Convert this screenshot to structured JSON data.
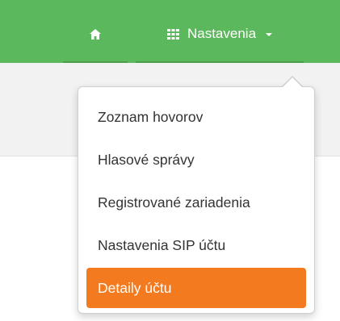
{
  "navbar": {
    "home_icon": "home-icon",
    "settings_icon": "grid-icon",
    "settings_label": "Nastavenia",
    "caret_icon": "caret-down-icon"
  },
  "menu": {
    "items": [
      {
        "label": "Zoznam hovorov",
        "active": false
      },
      {
        "label": "Hlasové správy",
        "active": false
      },
      {
        "label": "Registrované zariadenia",
        "active": false
      },
      {
        "label": "Nastavenia SIP účtu",
        "active": false
      },
      {
        "label": "Detaily účtu",
        "active": true
      }
    ]
  },
  "colors": {
    "navbar_bg": "#5cb85c",
    "active_item_bg": "#f47a20",
    "subbar_bg": "#f2f2f2"
  }
}
